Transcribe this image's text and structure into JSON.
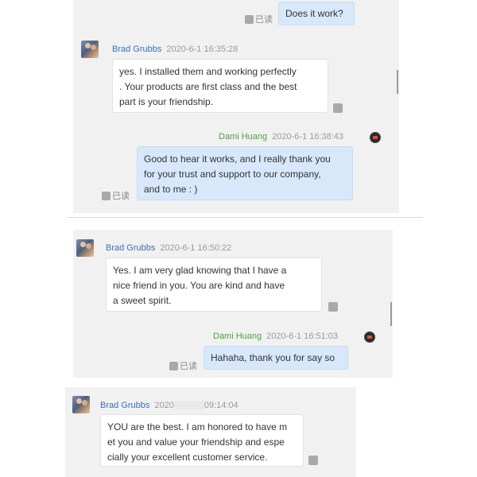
{
  "read_label": "已读",
  "screen1": {
    "prev_out": "Does it work?",
    "msg1": {
      "name": "Brad Grubbs",
      "time": "2020-6-1 16:35:28",
      "lines": [
        "yes. I installed them and working perfectly",
        ". Your products are first class and the best",
        "part is your friendship."
      ]
    },
    "msg2": {
      "name": "Dami Huang",
      "time": "2020-6-1 16:38:43",
      "lines": [
        "Good to hear it works, and I really thank you",
        "for your trust and support to our company,",
        "and to me : )"
      ]
    }
  },
  "screen2": {
    "msg1": {
      "name": "Brad Grubbs",
      "time": "2020-6-1 16:50:22",
      "lines": [
        "Yes.  I am very glad knowing that I have a",
        "nice friend in you. You are kind and have",
        "a sweet spirit."
      ]
    },
    "msg2": {
      "name": "Dami Huang",
      "time": "2020-6-1 16:51:03",
      "text": "Hahaha, thank you for say so"
    }
  },
  "screen3": {
    "msg1": {
      "name": "Brad Grubbs",
      "time_prefix": "2020",
      "time_suffix": "09:14:04",
      "lines": [
        "YOU are the best. I am honored to have m",
        "et you and value your friendship and espe",
        "cially your excellent customer service."
      ]
    }
  },
  "colors": {
    "outgoing_bubble": "#d7e8fb",
    "incoming_bubble": "#ffffff",
    "sender_name": "#3b6fb6",
    "self_name": "#4aa13f",
    "panel": "#f1f1f1"
  }
}
